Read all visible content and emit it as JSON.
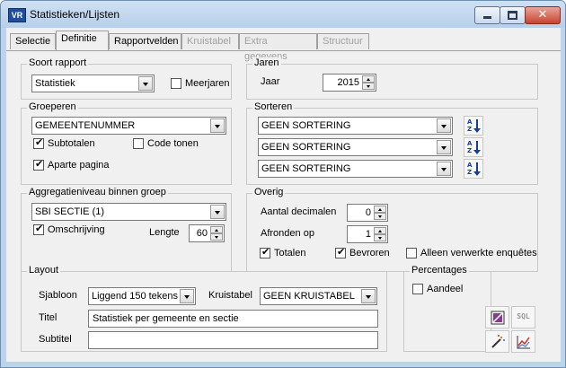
{
  "window": {
    "app_icon_text": "VR",
    "title": "Statistieken/Lijsten",
    "minimize_label": "",
    "maximize_label": "",
    "close_label": "✕"
  },
  "tabs": [
    {
      "label": "Selectie",
      "state": "normal"
    },
    {
      "label": "Definitie",
      "state": "active"
    },
    {
      "label": "Rapportvelden",
      "state": "normal"
    },
    {
      "label": "Kruistabel",
      "state": "disabled"
    },
    {
      "label": "Extra gegevens",
      "state": "disabled"
    },
    {
      "label": "Structuur",
      "state": "disabled"
    }
  ],
  "soort_rapport": {
    "legend": "Soort rapport",
    "select_value": "Statistiek",
    "meerjaren_label": "Meerjaren",
    "meerjaren_checked": false
  },
  "jaren": {
    "legend": "Jaren",
    "jaar_label": "Jaar",
    "jaar_value": "2015"
  },
  "groeperen": {
    "legend": "Groeperen",
    "select_value": "GEMEENTENUMMER",
    "subtotalen_label": "Subtotalen",
    "subtotalen_checked": true,
    "code_tonen_label": "Code tonen",
    "code_tonen_checked": false,
    "aparte_pagina_label": "Aparte pagina",
    "aparte_pagina_checked": true
  },
  "sorteren": {
    "legend": "Sorteren",
    "rows": [
      {
        "value": "GEEN SORTERING"
      },
      {
        "value": "GEEN SORTERING"
      },
      {
        "value": "GEEN SORTERING"
      }
    ]
  },
  "aggregatie": {
    "legend": "Aggregatieniveau binnen groep",
    "select_value": "SBI SECTIE (1)",
    "omschrijving_label": "Omschrijving",
    "omschrijving_checked": true,
    "lengte_label": "Lengte",
    "lengte_value": "60"
  },
  "overig": {
    "legend": "Overig",
    "decimalen_label": "Aantal decimalen",
    "decimalen_value": "0",
    "afronden_label": "Afronden op",
    "afronden_value": "1",
    "totalen_label": "Totalen",
    "totalen_checked": true,
    "bevroren_label": "Bevroren",
    "bevroren_checked": true,
    "alleen_label": "Alleen verwerkte enquêtes",
    "alleen_checked": false
  },
  "layout": {
    "legend": "Layout",
    "sjabloon_label": "Sjabloon",
    "sjabloon_value": "Liggend 150 tekens",
    "kruistabel_label": "Kruistabel",
    "kruistabel_value": "GEEN KRUISTABEL",
    "titel_label": "Titel",
    "titel_value": "Statistiek per gemeente en sectie",
    "subtitel_label": "Subtitel",
    "subtitel_value": ""
  },
  "percentages": {
    "legend": "Percentages",
    "aandeel_label": "Aandeel",
    "aandeel_checked": false
  },
  "toolbar": {
    "sql_label": "SQL"
  },
  "colors": {
    "title_bar": "#bcd3ec",
    "close_button": "#c7432f",
    "sort_icon": "#1a3d99"
  }
}
